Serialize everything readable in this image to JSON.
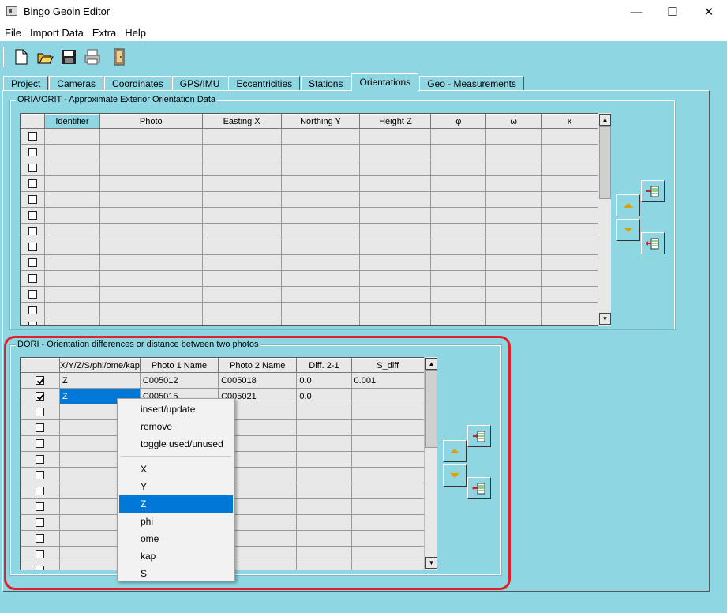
{
  "window": {
    "title": "Bingo Geoin Editor",
    "minimize": "—",
    "maximize": "☐",
    "close": "✕"
  },
  "menu": [
    "File",
    "Import Data",
    "Extra",
    "Help"
  ],
  "toolbar": [
    "new-file-icon",
    "open-folder-icon",
    "save-icon",
    "print-icon",
    "exit-door-icon"
  ],
  "tabs": [
    "Project",
    "Cameras",
    "Coordinates",
    "GPS/IMU",
    "Eccentricities",
    "Stations",
    "Orientations",
    "Geo - Measurements"
  ],
  "active_tab": "Orientations",
  "oria": {
    "title": "ORIA/ORIT - Approximate Exterior Orientation Data",
    "columns": [
      "",
      "Identifier",
      "Photo",
      "Easting X",
      "Northing Y",
      "Height Z",
      "φ",
      "ω",
      "κ"
    ]
  },
  "dori": {
    "title": "DORI - Orientation differences or distance between two photos",
    "columns": [
      "",
      "X/Y/Z/S/phi/ome/kap",
      "Photo 1 Name",
      "Photo 2 Name",
      "Diff. 2-1",
      "S_diff"
    ],
    "rows": [
      {
        "checked": true,
        "type": "Z",
        "photo1": "C005012",
        "photo2": "C005018",
        "diff": "0.0",
        "sdiff": "0.001"
      },
      {
        "checked": true,
        "type": "Z",
        "photo1": "C005015",
        "photo2": "C005021",
        "diff": "0.0",
        "sdiff": ""
      }
    ]
  },
  "context_menu": {
    "actions": [
      "insert/update",
      "remove",
      "toggle used/unused"
    ],
    "options": [
      "X",
      "Y",
      "Z",
      "phi",
      "ome",
      "kap",
      "S"
    ],
    "selected": "Z"
  },
  "colors": {
    "background": "#8fd6e3",
    "selection": "#0078d7",
    "highlight": "#e0202a"
  }
}
